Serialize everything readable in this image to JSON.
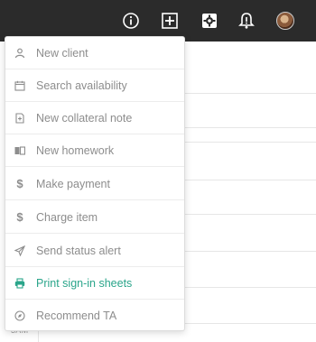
{
  "topbar": {
    "icons": [
      "info-icon",
      "add-icon",
      "settings-icon",
      "notification-icon",
      "avatar"
    ]
  },
  "calendar": {
    "time_label": "3AM"
  },
  "menu": {
    "items": [
      {
        "label": "New client",
        "icon": "person-icon"
      },
      {
        "label": "Search availability",
        "icon": "calendar-icon"
      },
      {
        "label": "New collateral note",
        "icon": "note-icon"
      },
      {
        "label": "New homework",
        "icon": "book-icon"
      },
      {
        "label": "Make payment",
        "icon": "dollar-icon"
      },
      {
        "label": "Charge item",
        "icon": "dollar-icon"
      },
      {
        "label": "Send status alert",
        "icon": "send-icon"
      },
      {
        "label": "Print sign-in sheets",
        "icon": "printer-icon",
        "active": true
      },
      {
        "label": "Recommend TA",
        "icon": "compass-icon"
      }
    ]
  },
  "colors": {
    "topbar": "#2b2b2b",
    "accent": "#2aa58a",
    "menu_text": "#8d8d8d"
  }
}
